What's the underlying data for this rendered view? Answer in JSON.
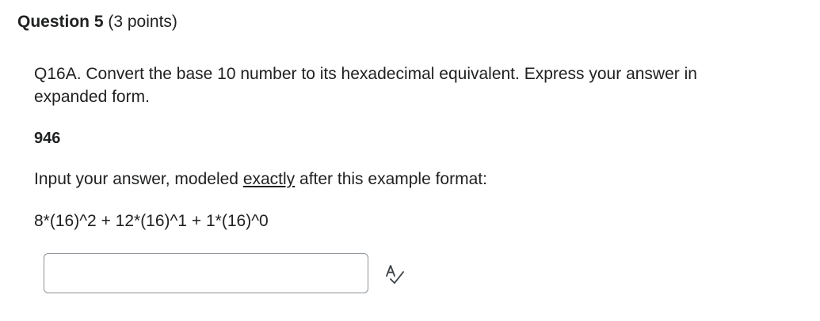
{
  "question": {
    "title": "Question 5",
    "points": "(3 points)",
    "prompt": "Q16A. Convert the base 10 number to its hexadecimal equivalent. Express your answer in expanded form.",
    "number": "946",
    "instructions_before": "Input your answer, modeled ",
    "instructions_emphasis": "exactly",
    "instructions_after": " after this example format:",
    "example": "8*(16)^2 + 12*(16)^1 + 1*(16)^0"
  },
  "answer": {
    "value": "",
    "placeholder": ""
  },
  "icons": {
    "spellcheck": "spellcheck-icon"
  }
}
